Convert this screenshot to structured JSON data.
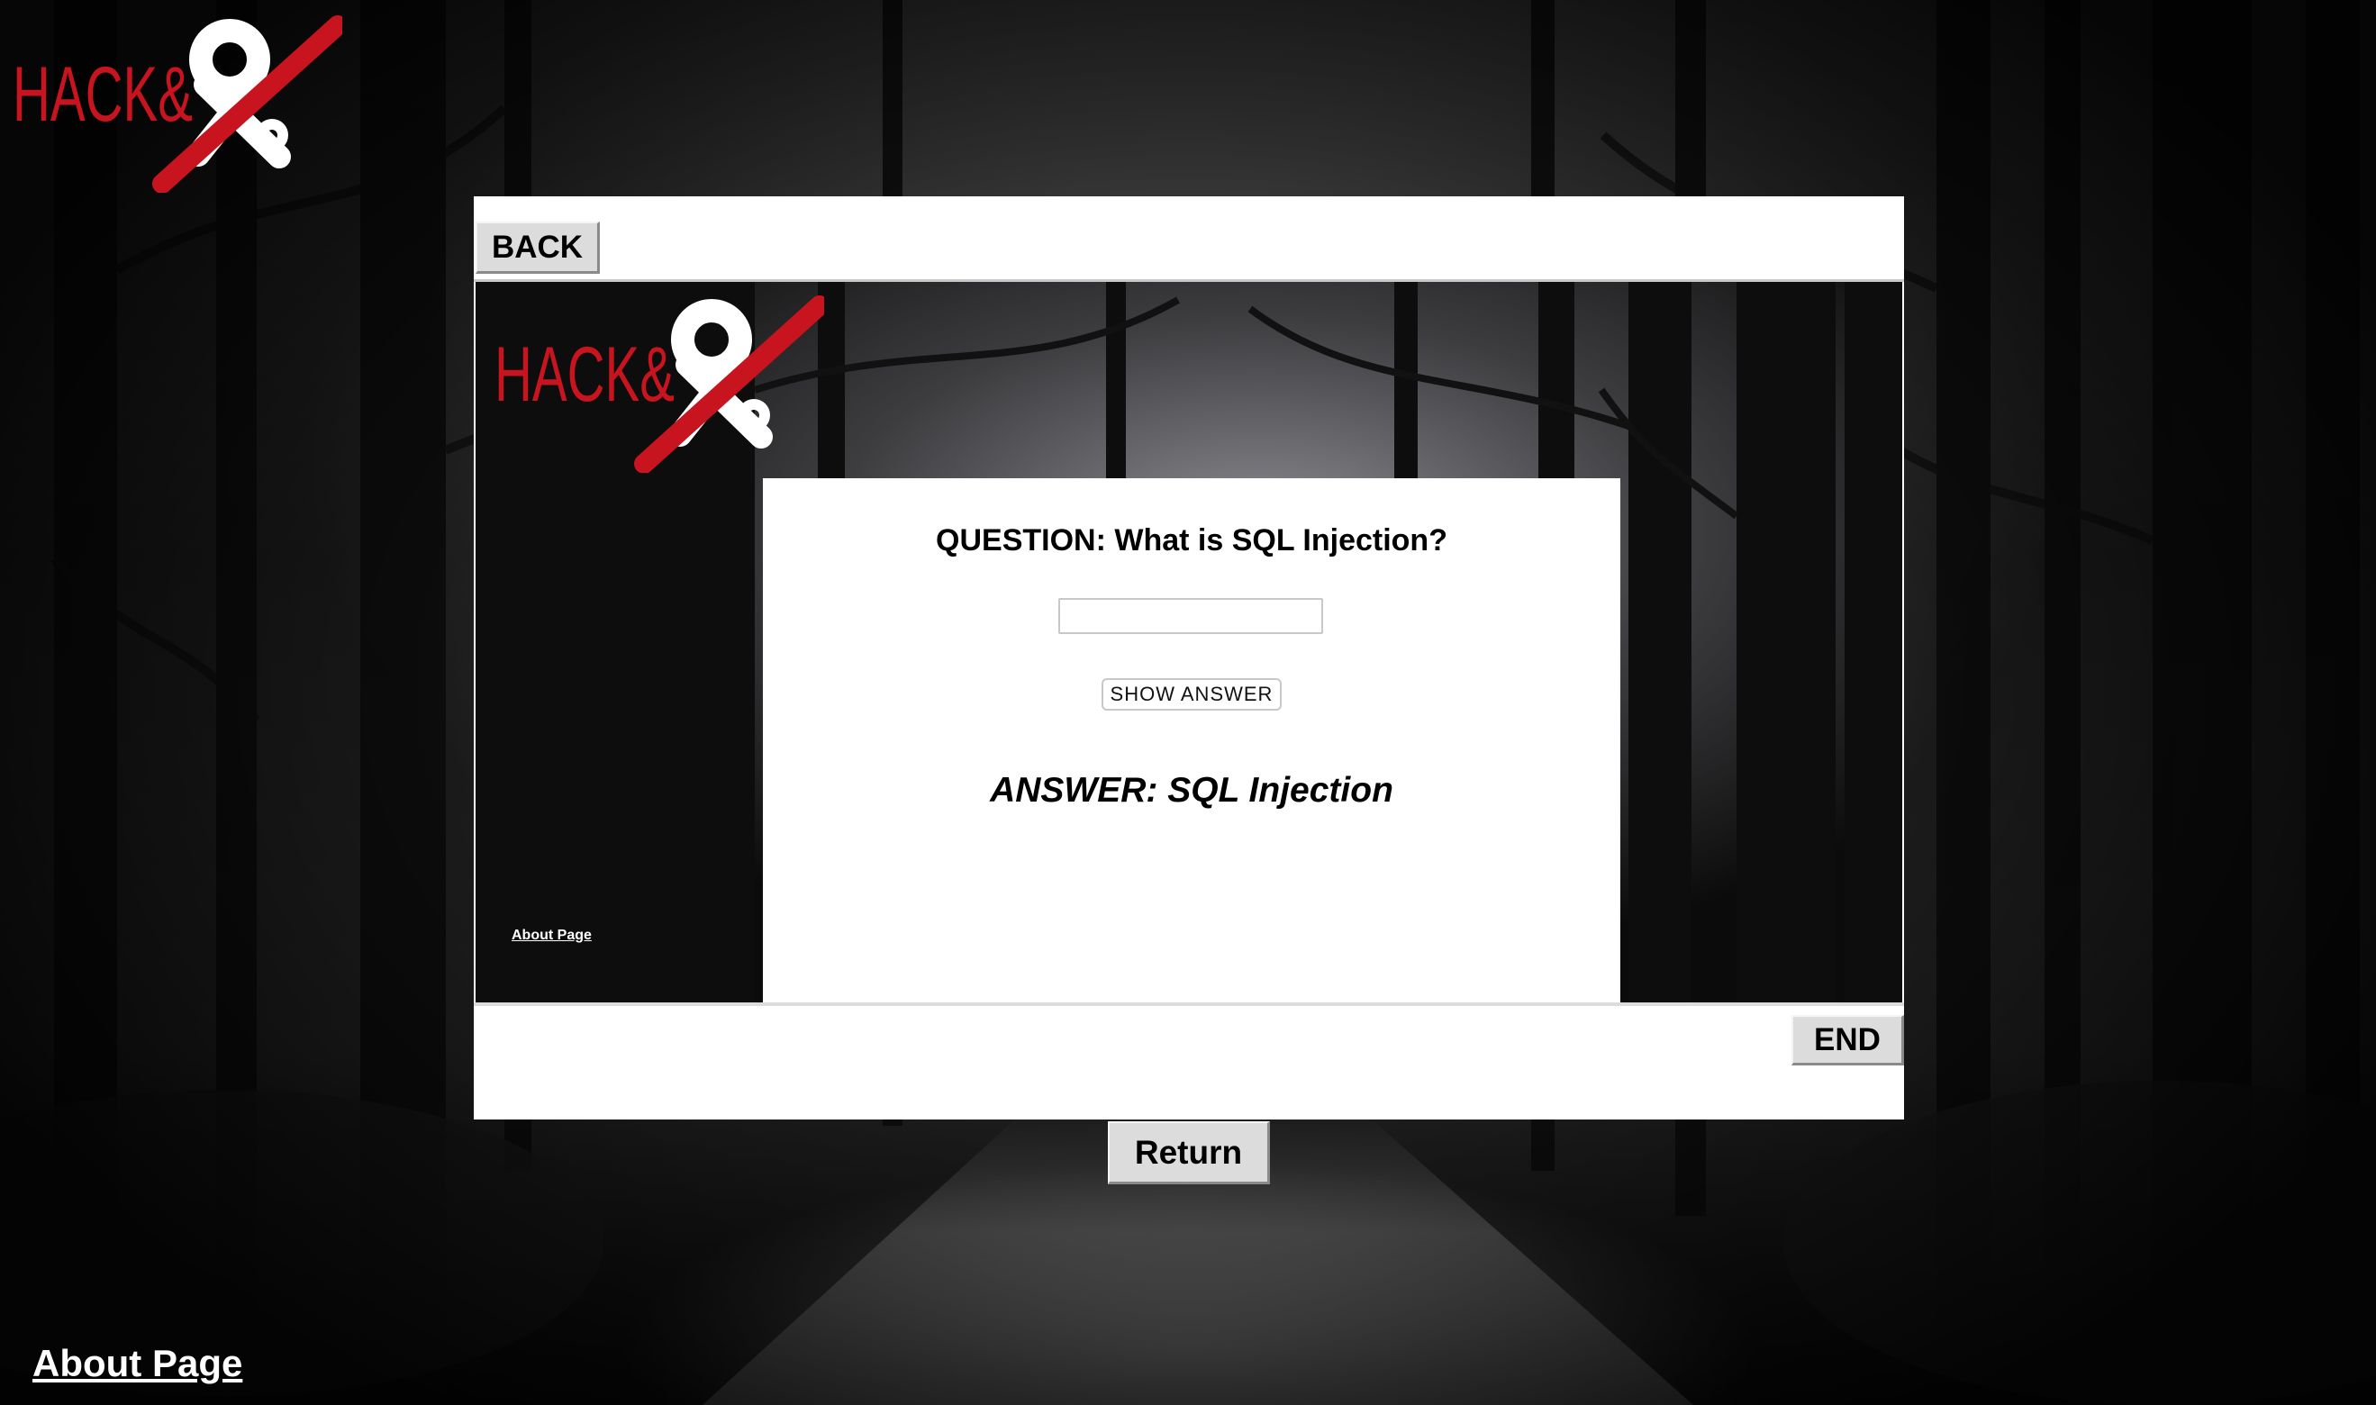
{
  "app": {
    "logo_text": "HACK&",
    "logo_accent_color": "#c8141e"
  },
  "toolbar": {
    "back_label": "BACK",
    "end_label": "END"
  },
  "quiz": {
    "question": "QUESTION: What is SQL Injection?",
    "answer_input_value": "",
    "answer_input_placeholder": "",
    "show_answer_label": "SHOW ANSWER",
    "answer": "ANSWER: SQL Injection"
  },
  "links": {
    "about_inner": "About Page",
    "about_main": "About Page"
  },
  "footer": {
    "return_label": "Return"
  }
}
